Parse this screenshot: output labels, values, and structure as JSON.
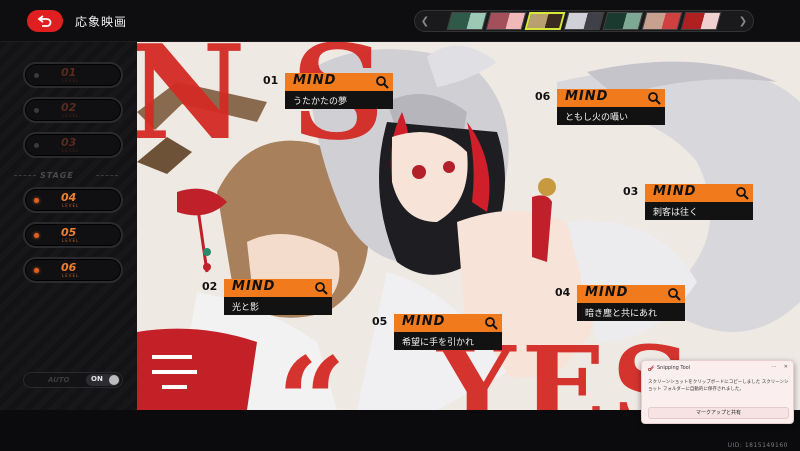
{
  "header": {
    "title": "応象映画",
    "back_icon": "back-arrow-icon"
  },
  "agent_strip": {
    "portraits": [
      {
        "color": "#2f5a4a",
        "accent": "#9cc9b4"
      },
      {
        "color": "#a3505a",
        "accent": "#f0b8b8"
      },
      {
        "color": "#b8a070",
        "accent": "#3a2a20",
        "active": true
      },
      {
        "color": "#d0d0d8",
        "accent": "#404048"
      },
      {
        "color": "#1a3a30",
        "accent": "#7ea894"
      },
      {
        "color": "#c8a090",
        "accent": "#d04040"
      },
      {
        "color": "#b02020",
        "accent": "#f0d0d0"
      }
    ]
  },
  "levels": {
    "stage_label": "STAGE",
    "level_word": "LEVEL",
    "items": [
      {
        "num": "01",
        "on": false
      },
      {
        "num": "02",
        "on": false
      },
      {
        "num": "03",
        "on": false
      },
      {
        "num": "04",
        "on": true
      },
      {
        "num": "05",
        "on": true
      },
      {
        "num": "06",
        "on": true
      }
    ]
  },
  "auto": {
    "label": "AUTO",
    "toggle_text": "ON"
  },
  "background_text": {
    "top": "N  S",
    "bottom": "YES",
    "quote": "“"
  },
  "mind_tags": [
    {
      "num": "01",
      "word": "MIND",
      "title": "うたかたの夢"
    },
    {
      "num": "02",
      "word": "MIND",
      "title": "光と影"
    },
    {
      "num": "03",
      "word": "MIND",
      "title": "刺客は往く"
    },
    {
      "num": "04",
      "word": "MIND",
      "title": "暗き塵と共にあれ"
    },
    {
      "num": "05",
      "word": "MIND",
      "title": "希望に手を引かれ"
    },
    {
      "num": "06",
      "word": "MIND",
      "title": "ともし火の囁い"
    }
  ],
  "uid": "UID: 1815149160",
  "toast": {
    "app": "Snipping Tool",
    "message": "スクリーンショットをクリップボードにコピーしました スクリーンショット フォルダーに自動的に保存されました。",
    "button": "マークアップと共有"
  },
  "colors": {
    "accent_orange": "#f07a1c",
    "accent_red": "#e02020",
    "bg_red_text": "#d42a24"
  }
}
